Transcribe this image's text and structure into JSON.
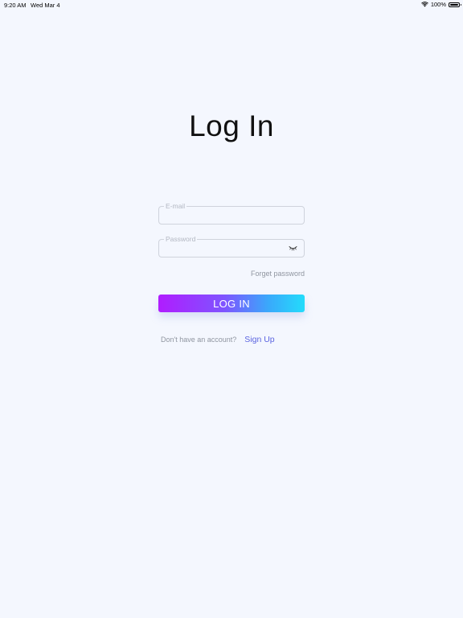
{
  "status_bar": {
    "time": "9:20 AM",
    "date": "Wed Mar 4",
    "wifi_icon": "wifi-icon",
    "battery": "100%",
    "battery_icon": "battery-full-icon"
  },
  "page": {
    "title": "Log In"
  },
  "form": {
    "email": {
      "label": "E-mail",
      "value": ""
    },
    "password": {
      "label": "Password",
      "value": "",
      "toggle_icon": "eye-closed-icon"
    },
    "forgot_label": "Forget password",
    "login_label": "LOG IN"
  },
  "signup": {
    "prompt": "Don't have an account?",
    "link_label": "Sign Up"
  },
  "colors": {
    "background": "#f4f7fe",
    "gradient_start": "#b01cff",
    "gradient_end": "#23dcfb",
    "link": "#5b64e0"
  }
}
